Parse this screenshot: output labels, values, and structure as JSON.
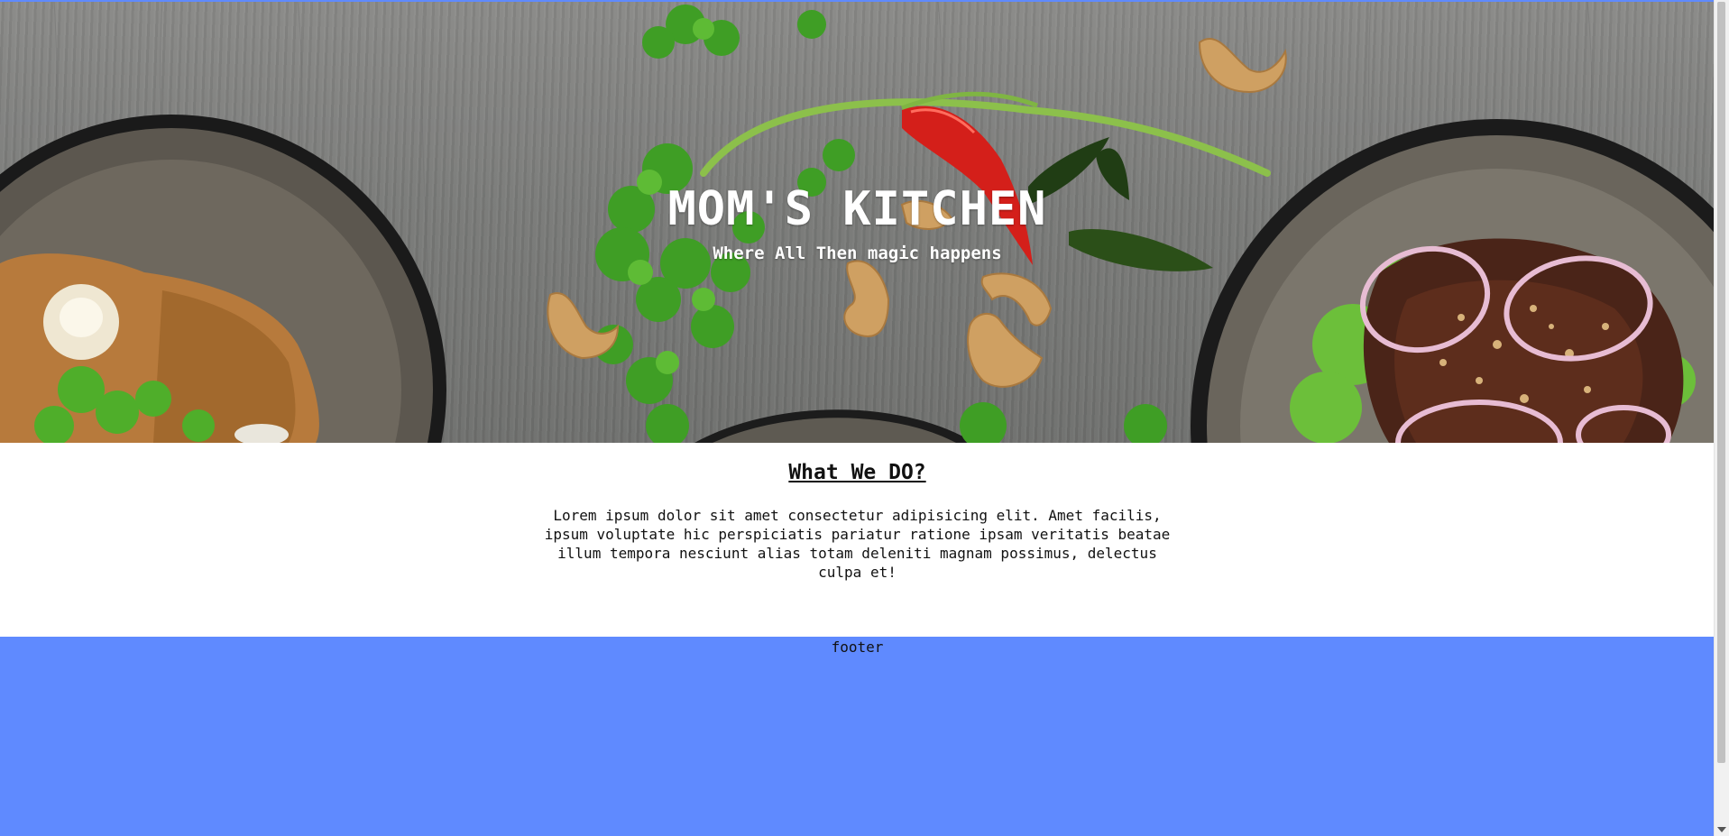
{
  "hero": {
    "title": "MOM'S KITCHEN",
    "subtitle": "Where All Then magic happens"
  },
  "about": {
    "heading": "What We DO?",
    "body": "Lorem ipsum dolor sit amet consectetur adipisicing elit. Amet facilis, ipsum voluptate hic perspiciatis pariatur ratione ipsam veritatis beatae illum tempora nesciunt alias totam deleniti magnam possimus, delectus culpa et!"
  },
  "footer": {
    "label": "footer"
  },
  "colors": {
    "footer_bg": "#5f8aff",
    "text": "#111111",
    "hero_text": "#ffffff"
  }
}
